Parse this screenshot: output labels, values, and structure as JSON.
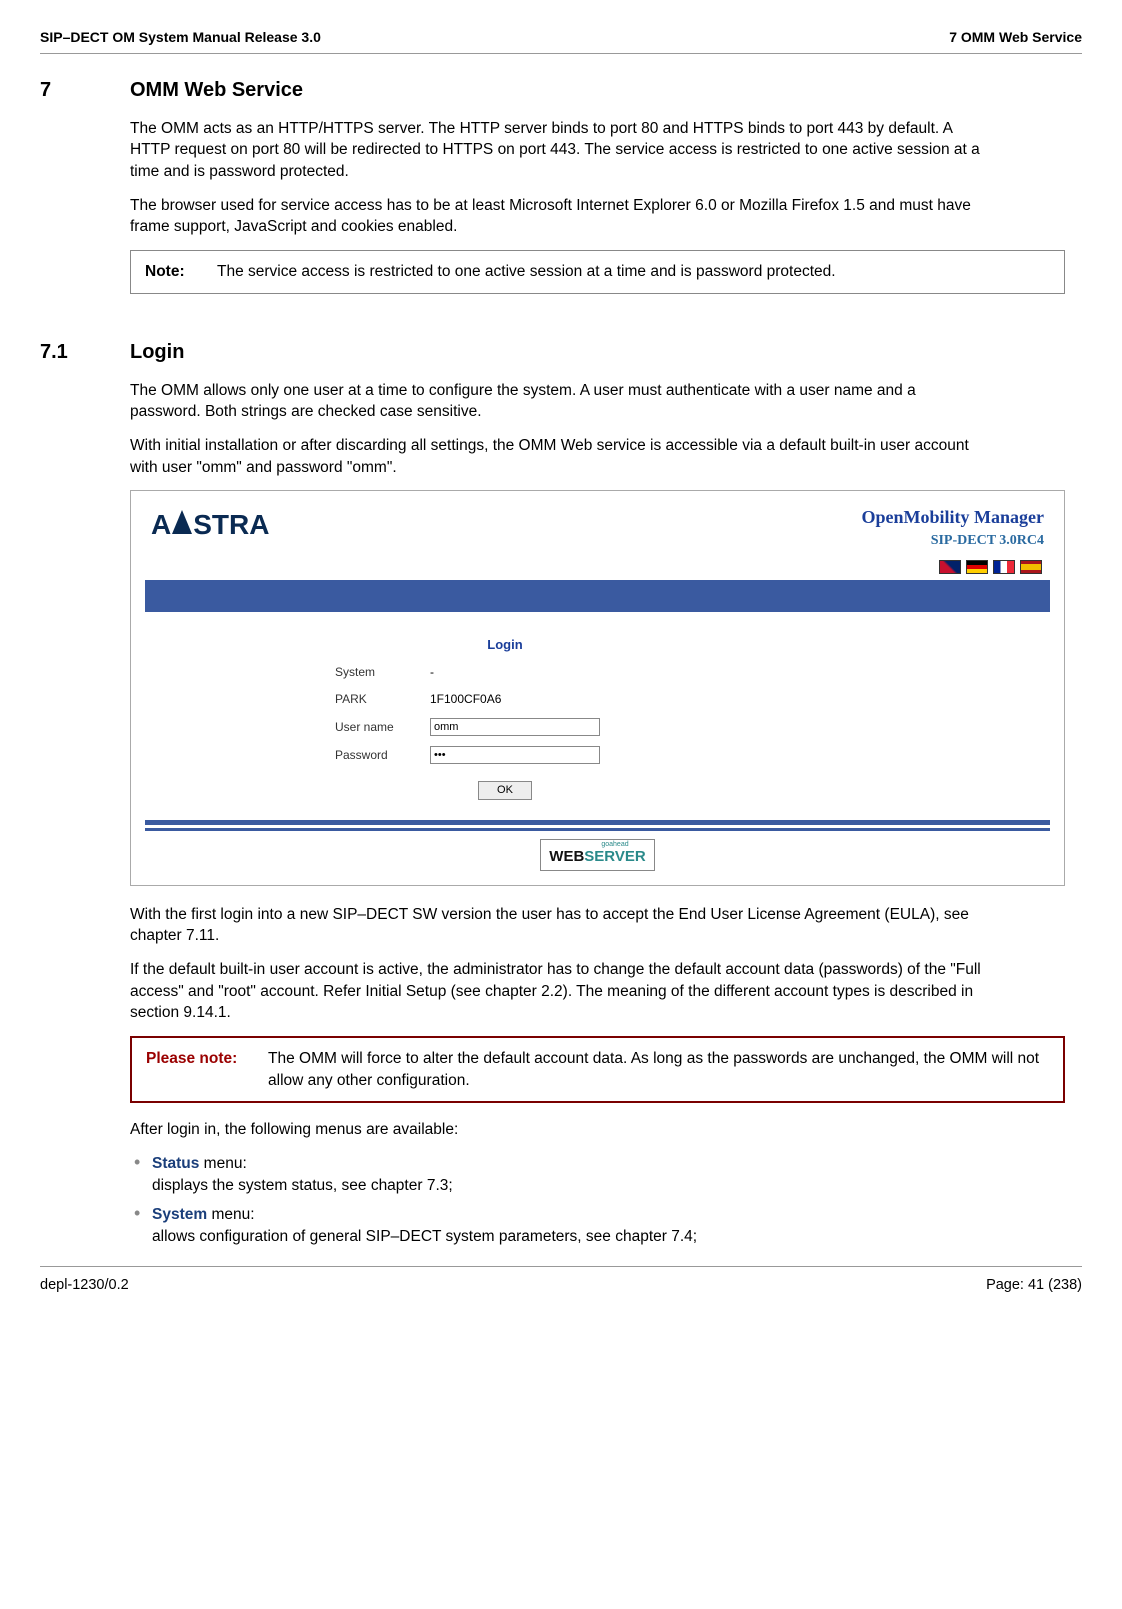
{
  "header": {
    "left": "SIP–DECT OM System Manual Release 3.0",
    "right": "7 OMM Web Service"
  },
  "section7": {
    "num": "7",
    "title": "OMM Web Service",
    "p1": "The OMM acts as an HTTP/HTTPS server. The HTTP server binds to port 80 and HTTPS binds to port 443 by default. A HTTP request on port 80 will be redirected to HTTPS on port 443. The service access is restricted to one active session at a time and is password protected.",
    "p2": "The browser used for service access has to be at least Microsoft Internet Explorer 6.0 or Mozilla Firefox 1.5 and must have frame support, JavaScript and cookies enabled.",
    "note_label": "Note:",
    "note_text": "The service access is restricted to one active session at a time and is password protected."
  },
  "section71": {
    "num": "7.1",
    "title": "Login",
    "p1": "The OMM allows only one user at a time to configure the system. A user must authenticate with a user name and a password. Both strings are checked case sensitive.",
    "p2": "With initial installation or after discarding all settings, the OMM Web service is accessible via a default built-in user account with user \"omm\" and password \"omm\".",
    "p3": "With the first login into a new SIP–DECT SW version the user has to accept the End User License Agreement (EULA), see chapter 7.11.",
    "p4": "If the default built-in user account is active, the administrator has to change the default account data (passwords) of the \"Full access\" and \"root\" account. Refer Initial Setup (see chapter 2.2). The meaning of the different account types is described in section 9.14.1.",
    "please_note_label": "Please note:",
    "please_note_text": "The OMM will force to alter the default account data. As long as the passwords are unchanged, the OMM will not allow any other configuration.",
    "after_login": "After login in, the following menus are available:",
    "menus": [
      {
        "name": "Status",
        "rest": " menu:",
        "desc": "displays the system status, see chapter 7.3;"
      },
      {
        "name": "System",
        "rest": " menu:",
        "desc": "allows configuration of general SIP–DECT system parameters, see chapter 7.4;"
      }
    ]
  },
  "screenshot": {
    "logo_text_a": "A",
    "logo_text_stra": "STRA",
    "product_title": "OpenMobility Manager",
    "product_sub": "SIP-DECT 3.0RC4",
    "login_heading": "Login",
    "rows": {
      "system_label": "System",
      "system_value": "-",
      "park_label": "PARK",
      "park_value": "1F100CF0A6",
      "username_label": "User name",
      "username_value": "omm",
      "password_label": "Password",
      "password_value": "•••"
    },
    "ok_label": "OK",
    "ws_goahead": "goahead",
    "ws_web": "WEB",
    "ws_server": "SERVER"
  },
  "footer": {
    "left": "depl-1230/0.2",
    "right": "Page: 41 (238)"
  }
}
